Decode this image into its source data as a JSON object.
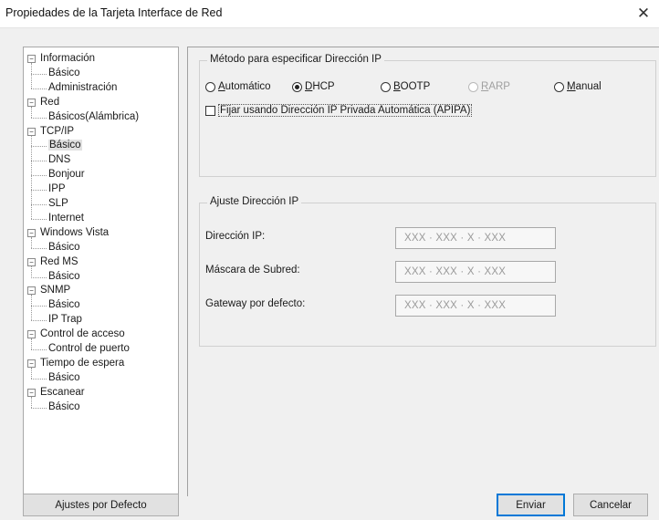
{
  "window": {
    "title": "Propiedades de la Tarjeta Interface de Red",
    "close_glyph": "✕"
  },
  "tree": {
    "items": [
      {
        "label": "Información",
        "level": 0
      },
      {
        "label": "Básico",
        "level": 1
      },
      {
        "label": "Administración",
        "level": 1
      },
      {
        "label": "Red",
        "level": 0
      },
      {
        "label": "Básicos(Alámbrica)",
        "level": 1
      },
      {
        "label": "TCP/IP",
        "level": 0
      },
      {
        "label": "Básico",
        "level": 1,
        "selected": true
      },
      {
        "label": "DNS",
        "level": 1
      },
      {
        "label": "Bonjour",
        "level": 1
      },
      {
        "label": "IPP",
        "level": 1
      },
      {
        "label": "SLP",
        "level": 1
      },
      {
        "label": "Internet",
        "level": 1
      },
      {
        "label": "Windows Vista",
        "level": 0
      },
      {
        "label": "Básico",
        "level": 1
      },
      {
        "label": "Red MS",
        "level": 0
      },
      {
        "label": "Básico",
        "level": 1
      },
      {
        "label": "SNMP",
        "level": 0
      },
      {
        "label": "Básico",
        "level": 1
      },
      {
        "label": "IP Trap",
        "level": 1
      },
      {
        "label": "Control de acceso",
        "level": 0
      },
      {
        "label": "Control de puerto",
        "level": 1
      },
      {
        "label": "Tiempo de espera",
        "level": 0
      },
      {
        "label": "Básico",
        "level": 1
      },
      {
        "label": "Escanear",
        "level": 0
      },
      {
        "label": "Básico",
        "level": 1
      }
    ]
  },
  "method_group": {
    "title": "Método para especificar Dirección IP",
    "radios": {
      "automatico": {
        "label": "Automático",
        "checked": false
      },
      "dhcp": {
        "label": "DHCP",
        "checked": true
      },
      "bootp": {
        "label": "BOOTP",
        "checked": false
      },
      "rarp": {
        "label": "RARP",
        "checked": false,
        "disabled": true
      },
      "manual": {
        "label": "Manual",
        "checked": false
      }
    },
    "apipa_checkbox": {
      "label": "Fijar usando Dirección IP Privada Automática (APIPA)",
      "checked": false
    }
  },
  "ip_group": {
    "title": "Ajuste Dirección IP",
    "fields": {
      "ip": {
        "label": "Dirección IP:",
        "value": "XXX · XXX · X · XXX"
      },
      "mask": {
        "label": "Máscara de Subred:",
        "value": "XXX · XXX · X · XXX"
      },
      "gateway": {
        "label": "Gateway por defecto:",
        "value": "XXX · XXX · X · XXX"
      }
    }
  },
  "buttons": {
    "defaults": "Ajustes por Defecto",
    "send": "Enviar",
    "cancel": "Cancelar"
  }
}
